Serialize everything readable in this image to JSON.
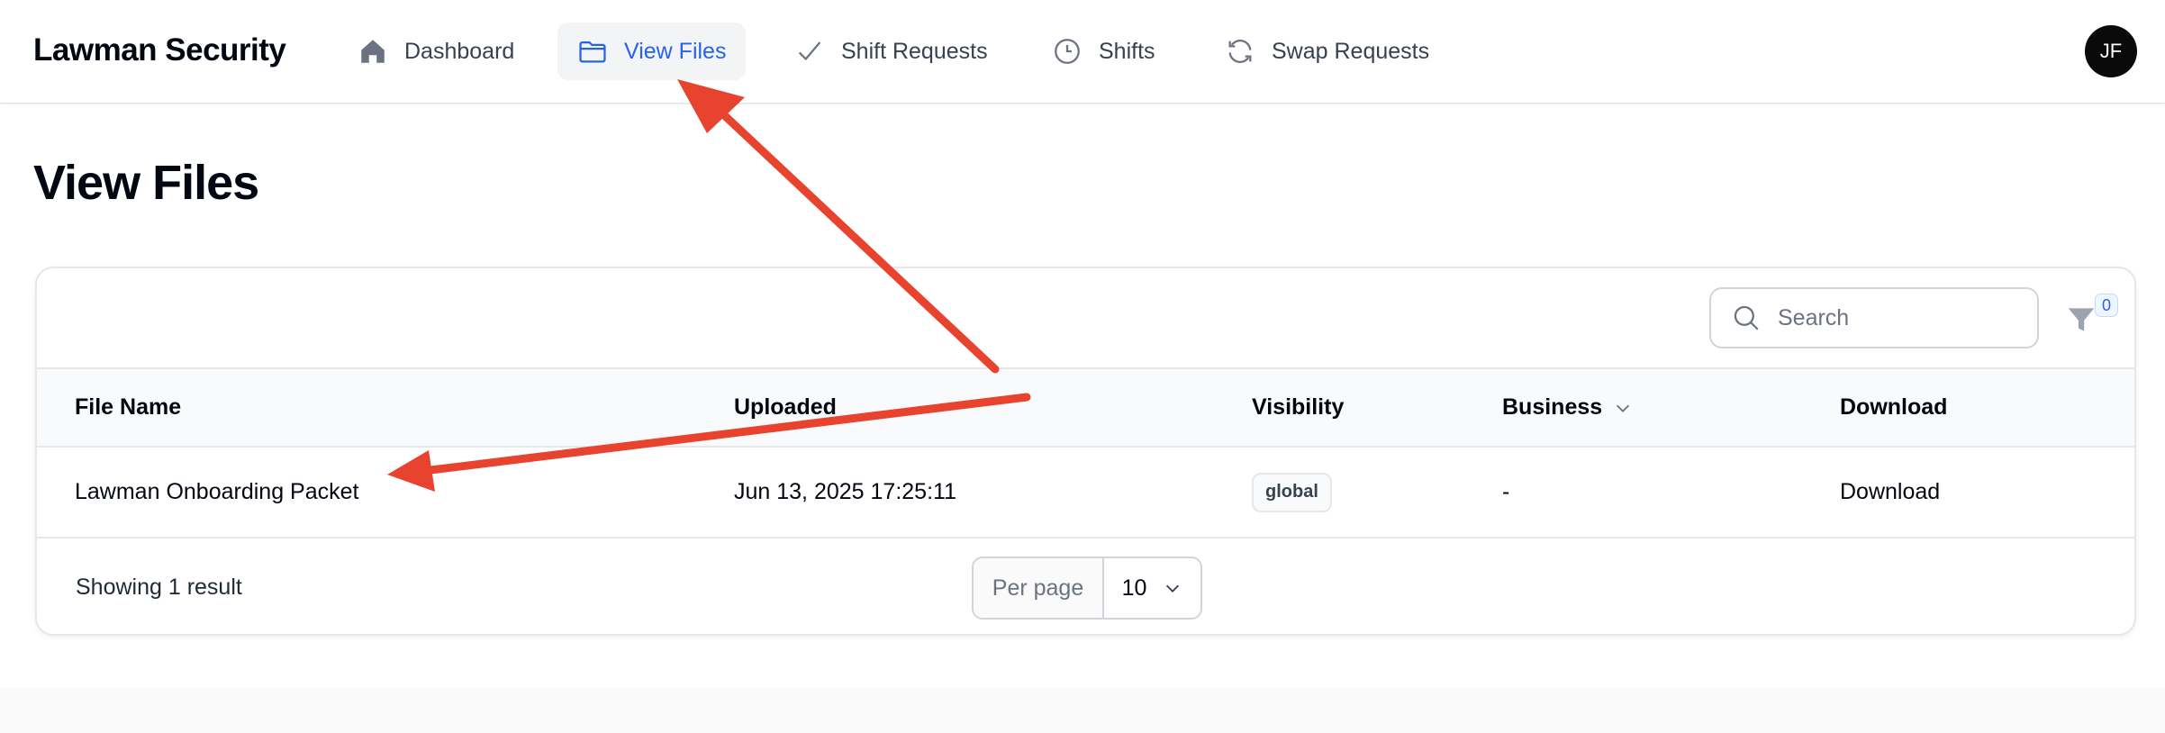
{
  "app": {
    "brand": "Lawman Security",
    "avatar_initials": "JF"
  },
  "nav": {
    "items": [
      {
        "label": "Dashboard",
        "icon": "home-icon",
        "active": false
      },
      {
        "label": "View Files",
        "icon": "folder-icon",
        "active": true
      },
      {
        "label": "Shift Requests",
        "icon": "check-icon",
        "active": false
      },
      {
        "label": "Shifts",
        "icon": "clock-icon",
        "active": false
      },
      {
        "label": "Swap Requests",
        "icon": "refresh-icon",
        "active": false
      }
    ],
    "active_color": "#2563eb"
  },
  "page": {
    "title": "View Files"
  },
  "toolbar": {
    "search_placeholder": "Search",
    "filter_count": "0"
  },
  "table": {
    "columns": [
      "File Name",
      "Uploaded",
      "Visibility",
      "Business",
      "Download"
    ],
    "rows": [
      {
        "file_name": "Lawman Onboarding Packet",
        "uploaded": "Jun 13, 2025 17:25:11",
        "visibility": "global",
        "business": "-",
        "download": "Download"
      }
    ]
  },
  "footer": {
    "result_text": "Showing 1 result",
    "per_page_label": "Per page",
    "per_page_value": "10"
  },
  "annotation": {
    "arrow_color": "#e8432e"
  }
}
